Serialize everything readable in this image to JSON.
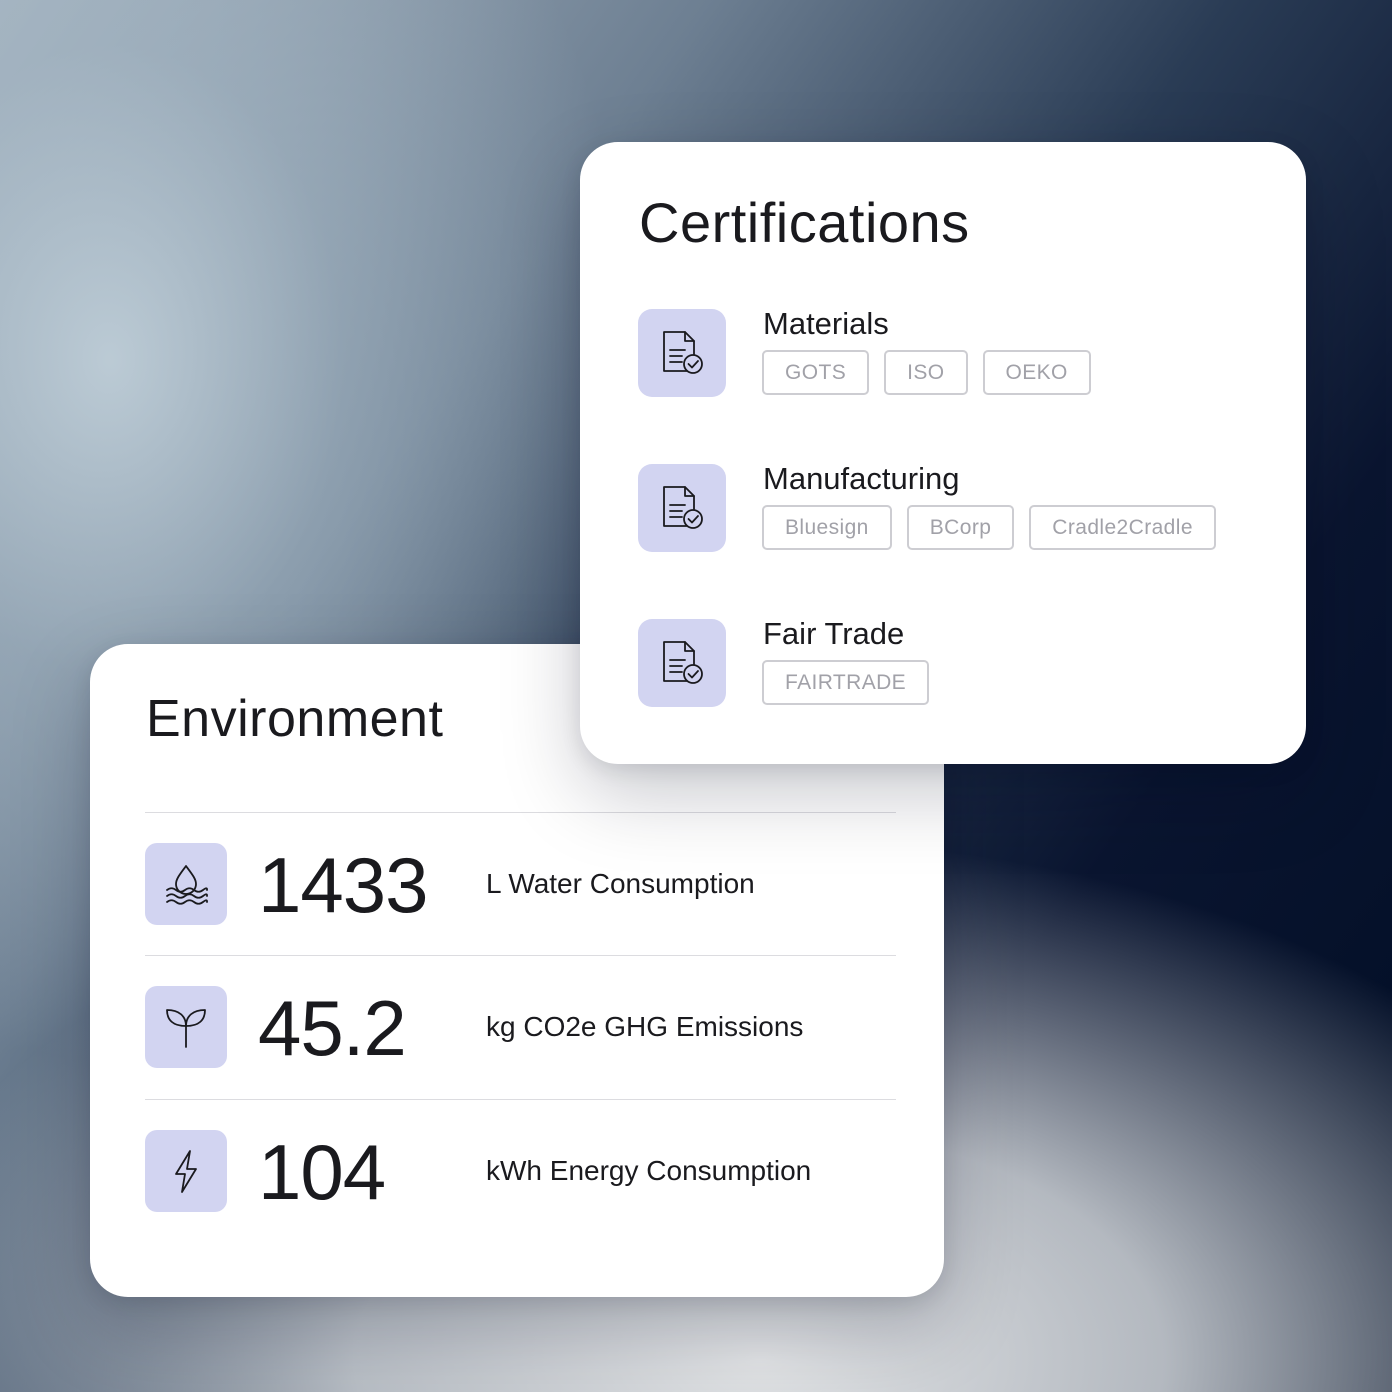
{
  "environment": {
    "title": "Environment",
    "metrics": [
      {
        "icon": "water-drop-icon",
        "value": "1433",
        "label": "L Water Consumption"
      },
      {
        "icon": "sprout-icon",
        "value": "45.2",
        "label": "kg CO2e GHG Emissions"
      },
      {
        "icon": "lightning-icon",
        "value": "104",
        "label": "kWh Energy Consumption"
      }
    ]
  },
  "certifications": {
    "title": "Certifications",
    "groups": [
      {
        "icon": "document-check-icon",
        "name": "Materials",
        "tags": [
          "GOTS",
          "ISO",
          "OEKO"
        ]
      },
      {
        "icon": "document-check-icon",
        "name": "Manufacturing",
        "tags": [
          "Bluesign",
          "BCorp",
          "Cradle2Cradle"
        ]
      },
      {
        "icon": "document-check-icon",
        "name": "Fair Trade",
        "tags": [
          "FAIRTRADE"
        ]
      }
    ]
  },
  "colors": {
    "icon_tile": "#d2d4f1",
    "text": "#1a1a1e",
    "tag_text": "#a1a1a8",
    "tag_border": "#cdcdd2",
    "background_dark": "#000d24",
    "background_light": "#c3ccd4"
  }
}
